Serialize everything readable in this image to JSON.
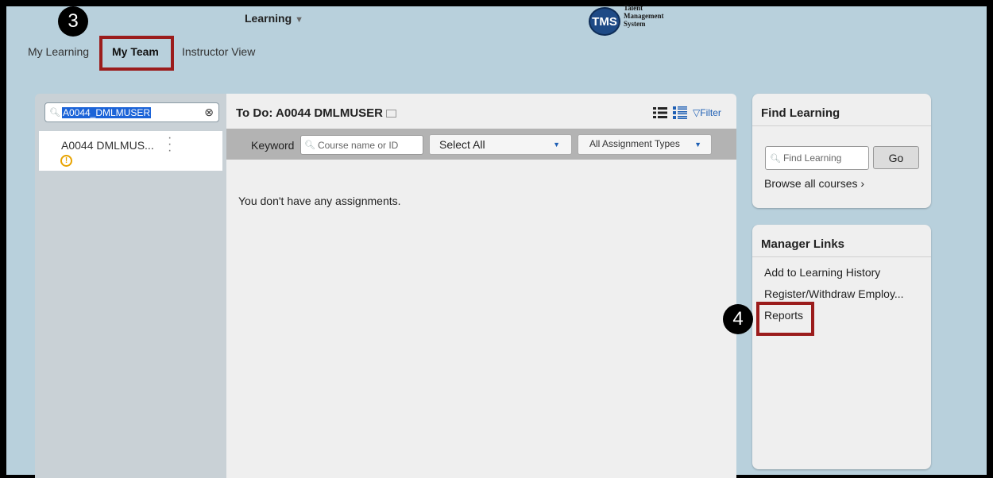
{
  "header": {
    "learning_menu": "Learning",
    "logo": {
      "badge": "TMS",
      "text_line1": "Talent",
      "text_line2": "Management",
      "text_line3": "System"
    }
  },
  "tabs": {
    "my_learning": "My Learning",
    "my_team": "My Team",
    "instructor_view": "Instructor View"
  },
  "annotations": {
    "step3": "3",
    "step4": "4",
    "highlight_color": "#9b1c1c"
  },
  "left_panel": {
    "search_value": "A0044_DMLMUSER",
    "users": [
      {
        "name": "A0044 DMLMUS..."
      }
    ]
  },
  "center_panel": {
    "title": "To Do: A0044 DMLMUSER",
    "filter_label": "Filter",
    "keyword_label": "Keyword",
    "keyword_placeholder": "Course name or ID",
    "select_all": "Select All",
    "assignment_types": "All Assignment Types",
    "empty_message": "You don't have any assignments."
  },
  "find_learning": {
    "title": "Find Learning",
    "placeholder": "Find Learning",
    "go_label": "Go",
    "browse_label": "Browse all courses"
  },
  "manager_links": {
    "title": "Manager Links",
    "items": [
      "Add to Learning History",
      "Register/Withdraw Employ...",
      "Reports"
    ]
  },
  "colors": {
    "background": "#b8d0dc",
    "link_blue": "#1e5fb4",
    "warning": "#e8a300"
  }
}
